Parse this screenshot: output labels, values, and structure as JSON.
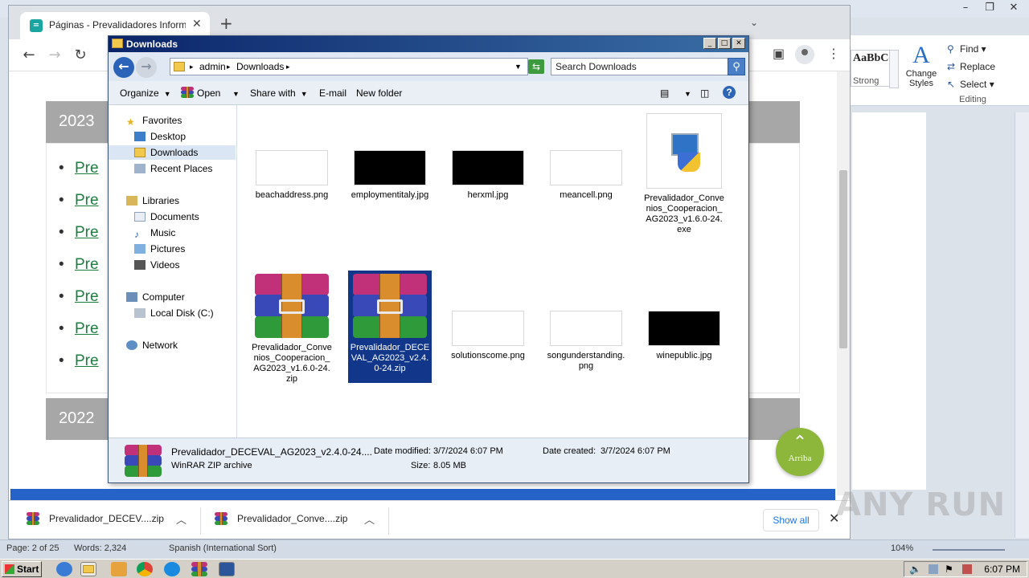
{
  "word": {
    "style_preview": "AaBbCcI",
    "style_name": "Strong",
    "change_styles": "Change Styles",
    "editing": {
      "find": "Find",
      "replace": "Replace",
      "select": "Select",
      "group_label": "Editing"
    },
    "status": {
      "page": "Page: 2 of 25",
      "words": "Words: 2,324",
      "language": "Spanish (International Sort)",
      "zoom": "104%"
    }
  },
  "chrome": {
    "tab_title": "Páginas - Prevalidadores Informacion",
    "page": {
      "year_2023": "2023",
      "year_2022": "2022",
      "link_prefix": "Pre",
      "fab_label": "Arriba"
    },
    "downloads": [
      {
        "name": "Prevalidador_DECEV....zip"
      },
      {
        "name": "Prevalidador_Conve....zip"
      }
    ],
    "show_all": "Show all"
  },
  "explorer": {
    "title": "Downloads",
    "breadcrumb": [
      "admin",
      "Downloads"
    ],
    "search_placeholder": "Search Downloads",
    "commands": {
      "organize": "Organize",
      "open": "Open",
      "share": "Share with",
      "email": "E-mail",
      "new_folder": "New folder"
    },
    "nav": {
      "favorites": "Favorites",
      "desktop": "Desktop",
      "downloads": "Downloads",
      "recent": "Recent Places",
      "libraries": "Libraries",
      "documents": "Documents",
      "music": "Music",
      "pictures": "Pictures",
      "videos": "Videos",
      "computer": "Computer",
      "local_disk": "Local Disk (C:)",
      "network": "Network"
    },
    "files": [
      {
        "name": "beachaddress.png"
      },
      {
        "name": "employmentitaly.jpg"
      },
      {
        "name": "herxml.jpg"
      },
      {
        "name": "meancell.png"
      },
      {
        "name": "Prevalidador_Convenios_Cooperacion_AG2023_v1.6.0-24.exe"
      },
      {
        "name": "Prevalidador_Convenios_Cooperacion_AG2023_v1.6.0-24.zip"
      },
      {
        "name": "Prevalidador_DECEVAL_AG2023_v2.4.0-24.zip"
      },
      {
        "name": "solutionscome.png"
      },
      {
        "name": "songunderstanding.png"
      },
      {
        "name": "winepublic.jpg"
      }
    ],
    "details": {
      "name": "Prevalidador_DECEVAL_AG2023_v2.4.0-24....",
      "type": "WinRAR ZIP archive",
      "modified_label": "Date modified:",
      "modified": "3/7/2024 6:07 PM",
      "created_label": "Date created:",
      "created": "3/7/2024 6:07 PM",
      "size_label": "Size:",
      "size": "8.05 MB"
    }
  },
  "taskbar": {
    "start": "Start",
    "time": "6:07 PM"
  },
  "watermark": "ANY RUN"
}
